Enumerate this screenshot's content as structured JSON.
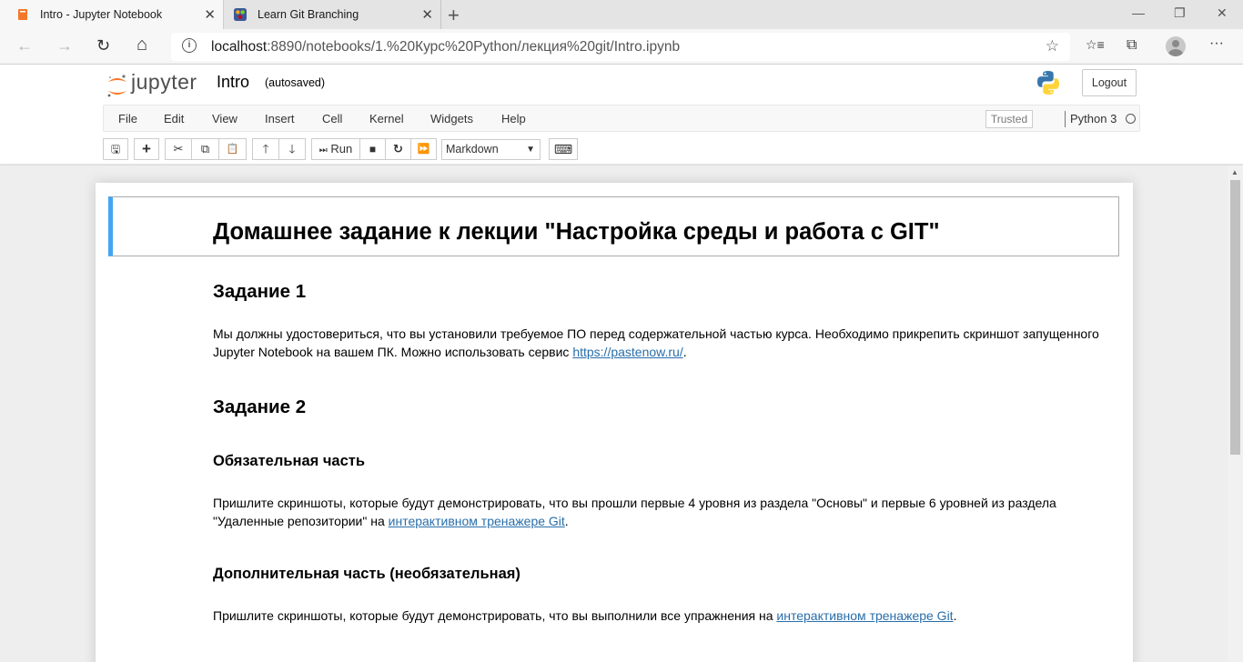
{
  "browser": {
    "tabs": [
      {
        "title": "Intro - Jupyter Notebook",
        "active": true
      },
      {
        "title": "Learn Git Branching",
        "active": false
      }
    ],
    "url_host": "localhost",
    "url_rest": ":8890/notebooks/1.%20Курс%20Python/лекция%20git/Intro.ipynb",
    "icons": {
      "back": "←",
      "forward": "→",
      "refresh": "↻",
      "home": "⌂",
      "star": "☆",
      "favorites": "☆≡",
      "collections": "⧉",
      "more": "···",
      "close": "✕",
      "newtab": "+",
      "minimize": "—",
      "restore": "❐"
    }
  },
  "jupyter": {
    "logo_text": "jupyter",
    "notebook_name": "Intro",
    "autosave_status": "(autosaved)",
    "logout_label": "Logout",
    "menu": [
      "File",
      "Edit",
      "View",
      "Insert",
      "Cell",
      "Kernel",
      "Widgets",
      "Help"
    ],
    "trusted_label": "Trusted",
    "kernel_name": "Python 3",
    "toolbar": {
      "save": "🖫",
      "add": "+",
      "cut": "✂",
      "copy": "⧉",
      "paste": "📋",
      "up": "🡑",
      "down": "🡓",
      "run_icon": "⏭",
      "run_label": "Run",
      "stop": "■",
      "restart": "↻",
      "fastforward": "⏩",
      "cell_type": "Markdown",
      "keyboard": "⌨"
    }
  },
  "notebook": {
    "title": "Домашнее задание к лекции \"Настройка среды и работа с GIT\"",
    "task1_heading": "Задание 1",
    "task1_text_line1": "Мы должны удостовериться, что вы установили требуемое ПО перед содержательной частью курса. Необходимо прикрепить скриншот запущенного",
    "task1_text_line2_pre": "Jupyter Notebook на вашем ПК. Можно использовать сервис ",
    "task1_link": "https://pastenow.ru/",
    "task1_text_line2_post": ".",
    "task2_heading": "Задание 2",
    "mandatory_heading": "Обязательная часть",
    "mandatory_line1": "Пришлите скриншоты, которые будут демонстрировать, что вы прошли первые 4 уровня из раздела \"Основы\" и первые 6 уровней из раздела",
    "mandatory_line2_pre": "\"Удаленные репозитории\" на ",
    "mandatory_link": "интерактивном тренажере Git",
    "mandatory_line2_post": ".",
    "optional_heading": "Дополнительная часть (необязательная)",
    "optional_pre": "Пришлите скриншоты, которые будут демонстрировать, что вы выполнили все упражнения на ",
    "optional_link": "интерактивном тренажере Git",
    "optional_post": "."
  },
  "colors": {
    "selected_cell_border": "#42a5f5",
    "link": "#296eaa",
    "jupyter_orange": "#f37726"
  }
}
